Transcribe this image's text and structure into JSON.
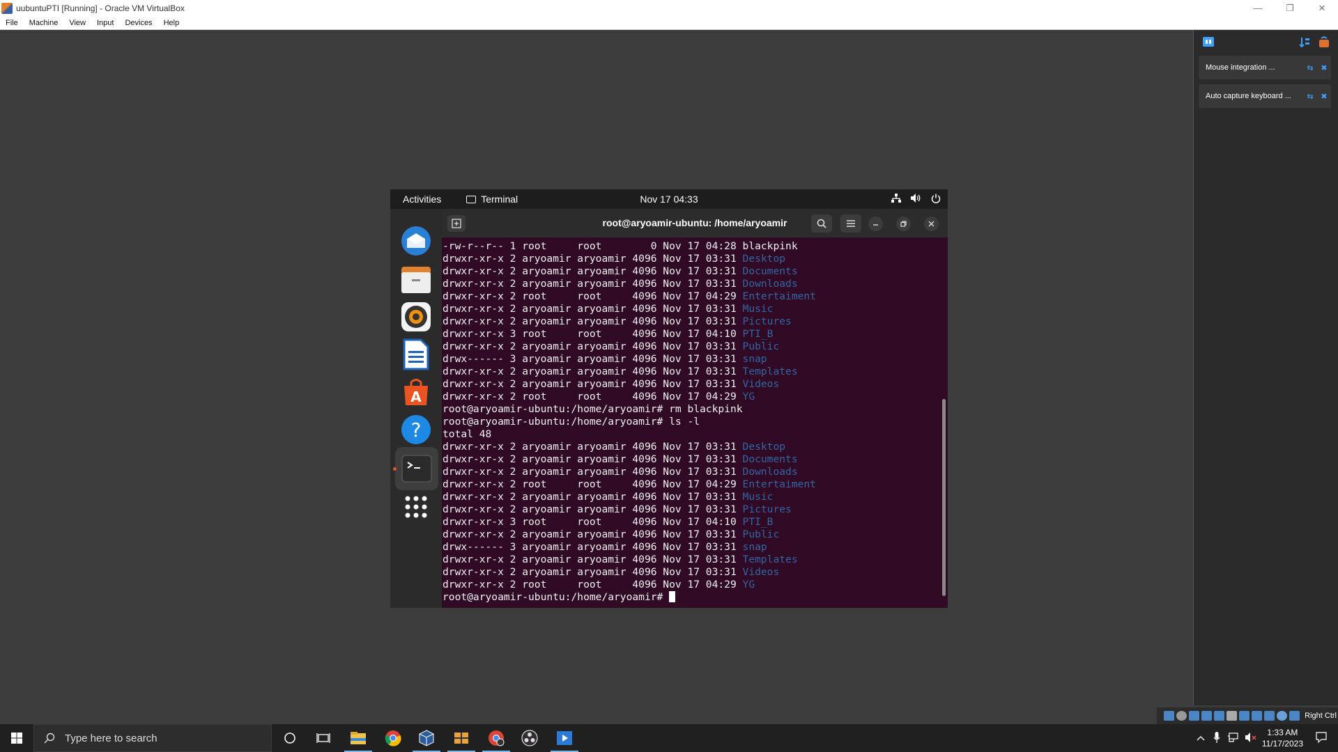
{
  "host": {
    "window_title": "uubuntuPTI [Running] - Oracle VM VirtualBox",
    "menu": [
      "File",
      "Machine",
      "View",
      "Input",
      "Devices",
      "Help"
    ],
    "notifications": [
      {
        "text": "Mouse integration ..."
      },
      {
        "text": "Auto capture keyboard ..."
      }
    ],
    "host_key_label": "Right Ctrl"
  },
  "guest": {
    "topbar": {
      "activities": "Activities",
      "app_name": "Terminal",
      "clock": "Nov 17  04:33"
    },
    "dock_apps": [
      "thunderbird-icon",
      "files-icon",
      "rhythmbox-icon",
      "writer-icon",
      "software-icon",
      "help-icon",
      "terminal-icon",
      "show-apps-icon"
    ],
    "terminal": {
      "title": "root@aryoamir-ubuntu: /home/aryoamir",
      "prompt": "root@aryoamir-ubuntu:/home/aryoamir#",
      "lines": [
        {
          "pre": "-rw-r--r-- 1 root     root        0 Nov 17 04:28 ",
          "name": "blackpink",
          "dir": false
        },
        {
          "pre": "drwxr-xr-x 2 aryoamir aryoamir 4096 Nov 17 03:31 ",
          "name": "Desktop",
          "dir": true
        },
        {
          "pre": "drwxr-xr-x 2 aryoamir aryoamir 4096 Nov 17 03:31 ",
          "name": "Documents",
          "dir": true
        },
        {
          "pre": "drwxr-xr-x 2 aryoamir aryoamir 4096 Nov 17 03:31 ",
          "name": "Downloads",
          "dir": true
        },
        {
          "pre": "drwxr-xr-x 2 root     root     4096 Nov 17 04:29 ",
          "name": "Entertaiment",
          "dir": true
        },
        {
          "pre": "drwxr-xr-x 2 aryoamir aryoamir 4096 Nov 17 03:31 ",
          "name": "Music",
          "dir": true
        },
        {
          "pre": "drwxr-xr-x 2 aryoamir aryoamir 4096 Nov 17 03:31 ",
          "name": "Pictures",
          "dir": true
        },
        {
          "pre": "drwxr-xr-x 3 root     root     4096 Nov 17 04:10 ",
          "name": "PTI_B",
          "dir": true
        },
        {
          "pre": "drwxr-xr-x 2 aryoamir aryoamir 4096 Nov 17 03:31 ",
          "name": "Public",
          "dir": true
        },
        {
          "pre": "drwx------ 3 aryoamir aryoamir 4096 Nov 17 03:31 ",
          "name": "snap",
          "dir": true
        },
        {
          "pre": "drwxr-xr-x 2 aryoamir aryoamir 4096 Nov 17 03:31 ",
          "name": "Templates",
          "dir": true
        },
        {
          "pre": "drwxr-xr-x 2 aryoamir aryoamir 4096 Nov 17 03:31 ",
          "name": "Videos",
          "dir": true
        },
        {
          "pre": "drwxr-xr-x 2 root     root     4096 Nov 17 04:29 ",
          "name": "YG",
          "dir": true
        },
        {
          "pre": "root@aryoamir-ubuntu:/home/aryoamir# rm blackpink",
          "name": "",
          "dir": false
        },
        {
          "pre": "root@aryoamir-ubuntu:/home/aryoamir# ls -l",
          "name": "",
          "dir": false
        },
        {
          "pre": "total 48",
          "name": "",
          "dir": false
        },
        {
          "pre": "drwxr-xr-x 2 aryoamir aryoamir 4096 Nov 17 03:31 ",
          "name": "Desktop",
          "dir": true
        },
        {
          "pre": "drwxr-xr-x 2 aryoamir aryoamir 4096 Nov 17 03:31 ",
          "name": "Documents",
          "dir": true
        },
        {
          "pre": "drwxr-xr-x 2 aryoamir aryoamir 4096 Nov 17 03:31 ",
          "name": "Downloads",
          "dir": true
        },
        {
          "pre": "drwxr-xr-x 2 root     root     4096 Nov 17 04:29 ",
          "name": "Entertaiment",
          "dir": true
        },
        {
          "pre": "drwxr-xr-x 2 aryoamir aryoamir 4096 Nov 17 03:31 ",
          "name": "Music",
          "dir": true
        },
        {
          "pre": "drwxr-xr-x 2 aryoamir aryoamir 4096 Nov 17 03:31 ",
          "name": "Pictures",
          "dir": true
        },
        {
          "pre": "drwxr-xr-x 3 root     root     4096 Nov 17 04:10 ",
          "name": "PTI_B",
          "dir": true
        },
        {
          "pre": "drwxr-xr-x 2 aryoamir aryoamir 4096 Nov 17 03:31 ",
          "name": "Public",
          "dir": true
        },
        {
          "pre": "drwx------ 3 aryoamir aryoamir 4096 Nov 17 03:31 ",
          "name": "snap",
          "dir": true
        },
        {
          "pre": "drwxr-xr-x 2 aryoamir aryoamir 4096 Nov 17 03:31 ",
          "name": "Templates",
          "dir": true
        },
        {
          "pre": "drwxr-xr-x 2 aryoamir aryoamir 4096 Nov 17 03:31 ",
          "name": "Videos",
          "dir": true
        },
        {
          "pre": "drwxr-xr-x 2 root     root     4096 Nov 17 04:29 ",
          "name": "YG",
          "dir": true
        }
      ]
    }
  },
  "taskbar": {
    "search_placeholder": "Type here to search",
    "time": "1:33 AM",
    "date": "11/17/2023",
    "pinned": [
      "file-explorer-icon",
      "chrome-icon",
      "virtualbox-icon",
      "app-icon",
      "chrome-profile-icon",
      "obs-icon",
      "media-app-icon"
    ]
  },
  "colors": {
    "terminal_bg": "#300a24",
    "dir_color": "#3465a4",
    "ubuntu_orange": "#e95420"
  }
}
